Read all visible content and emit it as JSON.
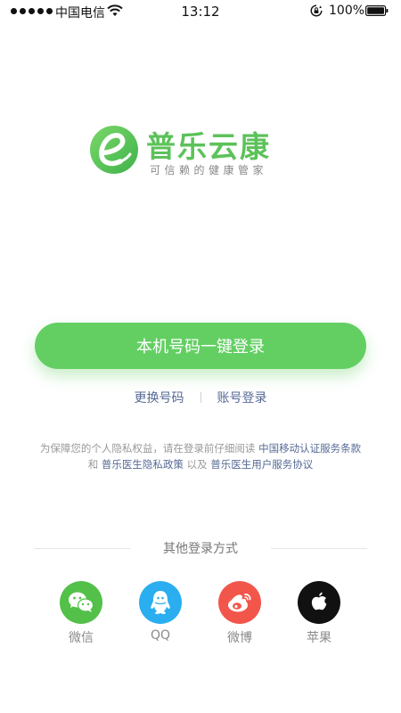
{
  "status_bar": {
    "carrier": "中国电信",
    "time": "13:12",
    "battery": "100%"
  },
  "brand": {
    "name": "普乐云康",
    "slogan": "可信赖的健康管家",
    "color": "#5cc25a"
  },
  "login": {
    "primary_label": "本机号码一键登录",
    "primary_color": "#63cf63",
    "change_number": "更换号码",
    "account_login": "账号登录"
  },
  "agreement": {
    "prefix": "为保障您的个人隐私权益，请在登录前仔细阅读 ",
    "link1": "中国移动认证服务条款",
    "and": " 和 ",
    "link2": "普乐医生隐私政策",
    "also": " 以及 ",
    "link3": "普乐医生用户服务协议"
  },
  "other_login": {
    "title": "其他登录方式",
    "options": [
      {
        "label": "微信",
        "icon": "wechat-icon",
        "color": "#53c04a"
      },
      {
        "label": "QQ",
        "icon": "qq-icon",
        "color": "#2aaef0"
      },
      {
        "label": "微博",
        "icon": "weibo-icon",
        "color": "#f2564b"
      },
      {
        "label": "苹果",
        "icon": "apple-icon",
        "color": "#111111"
      }
    ]
  }
}
